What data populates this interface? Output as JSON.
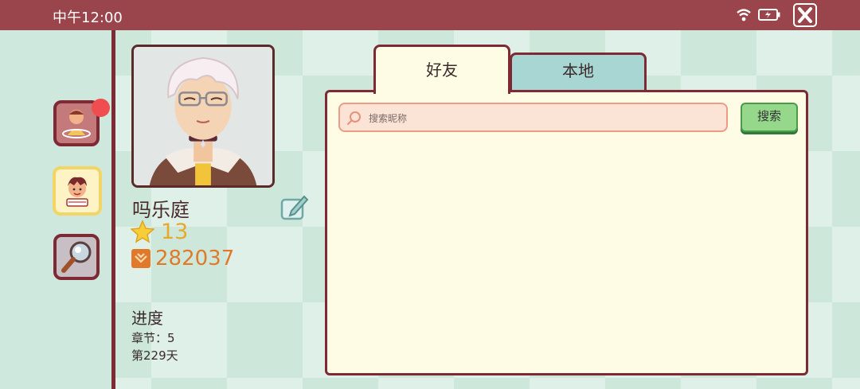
{
  "status_bar": {
    "time": "中午12:00"
  },
  "profile": {
    "name": "吗乐庭",
    "stars": "13",
    "coins": "282037",
    "progress_title": "进度",
    "chapter": "章节：5",
    "day": "第229天"
  },
  "tabs": [
    {
      "label": "好友",
      "active": true
    },
    {
      "label": "本地",
      "active": false
    }
  ],
  "search": {
    "placeholder": "搜索昵称",
    "button_label": "搜索"
  },
  "sidebar": {
    "items": [
      {
        "name": "character-outfit",
        "badge": true
      },
      {
        "name": "friends",
        "active": true
      },
      {
        "name": "explore"
      }
    ]
  },
  "colors": {
    "topbar": "#9a444b",
    "border": "#7d2a35",
    "panel": "#fffce6",
    "star_text": "#e8a82a",
    "coin_text": "#e07a2a",
    "search_button": "#95d88c"
  },
  "icons": [
    "wifi-icon",
    "battery-icon",
    "close-icon",
    "edit-icon",
    "star-icon",
    "coin-icon",
    "search-icon",
    "magnifier-icon"
  ]
}
